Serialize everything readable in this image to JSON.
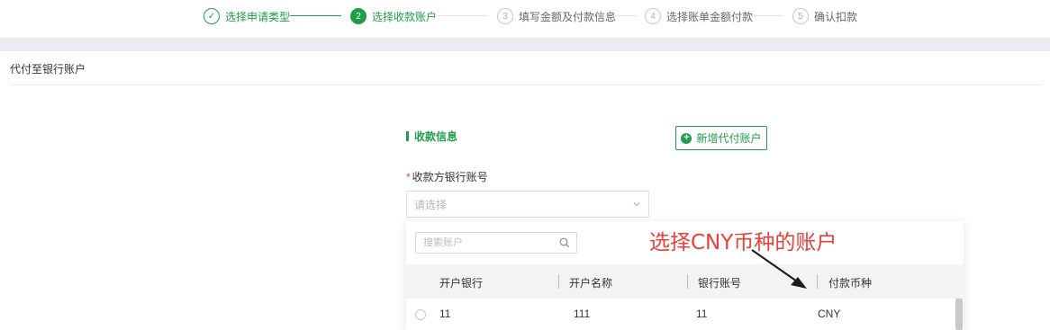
{
  "steps": [
    {
      "index": "✓",
      "label": "选择申请类型",
      "state": "done"
    },
    {
      "index": "2",
      "label": "选择收款账户",
      "state": "active"
    },
    {
      "index": "3",
      "label": "填写金额及付款信息",
      "state": "pending"
    },
    {
      "index": "4",
      "label": "选择账单金额付款",
      "state": "pending"
    },
    {
      "index": "5",
      "label": "确认扣款",
      "state": "pending"
    }
  ],
  "section_title": "代付至银行账户",
  "form": {
    "info_title": "收款信息",
    "add_button": "新增代付账户",
    "required_mark": "*",
    "account_label": "收款方银行账号",
    "select_placeholder": "请选择"
  },
  "dropdown": {
    "search_placeholder": "搜索账户",
    "columns": [
      "开户银行",
      "开户名称",
      "银行账号",
      "付款币种"
    ],
    "rows": [
      {
        "bank": "11",
        "name": "111",
        "account": "11",
        "currency": "CNY"
      }
    ]
  },
  "annotation": "选择CNY币种的账户",
  "colors": {
    "accent": "#1f9d4a",
    "annotation": "#e8403a"
  }
}
